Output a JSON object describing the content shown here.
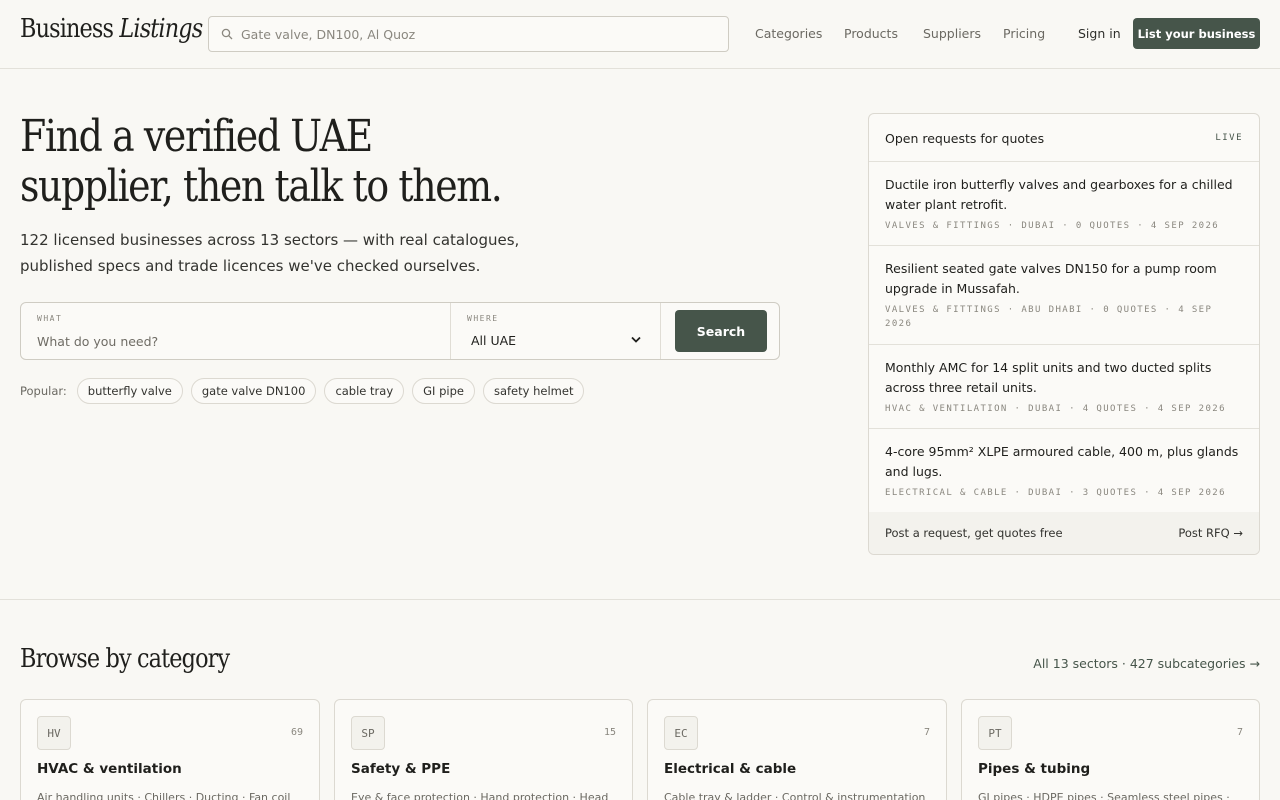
{
  "header": {
    "logo_regular": "Business ",
    "logo_italic": "Listings",
    "search_placeholder": "Gate valve, DN100, Al Quoz",
    "nav": [
      "Categories",
      "Products",
      "Suppliers",
      "Pricing"
    ],
    "sign_in": "Sign in",
    "list_business": "List your business"
  },
  "hero": {
    "title": "Find a verified UAE supplier, then talk to them.",
    "subtitle": "122 licensed businesses across 13 sectors — with real catalogues, published specs and trade licences we've checked ourselves.",
    "search": {
      "what_label": "WHAT",
      "what_placeholder": "What do you need?",
      "where_label": "WHERE",
      "where_value": "All UAE",
      "button": "Search"
    },
    "popular_label": "Popular:",
    "popular": [
      "butterfly valve",
      "gate valve DN100",
      "cable tray",
      "GI pipe",
      "safety helmet"
    ]
  },
  "rfq": {
    "title": "Open requests for quotes",
    "live": "LIVE",
    "items": [
      {
        "text": "Ductile iron butterfly valves and gearboxes for a chilled water plant retrofit.",
        "meta": "Valves & fittings · Dubai · 0 quotes · 4 Sep 2026"
      },
      {
        "text": "Resilient seated gate valves DN150 for a pump room upgrade in Mussafah.",
        "meta": "Valves & fittings · Abu Dhabi · 0 quotes · 4 Sep 2026"
      },
      {
        "text": "Monthly AMC for 14 split units and two ducted splits across three retail units.",
        "meta": "HVAC & ventilation · Dubai · 4 quotes · 4 Sep 2026"
      },
      {
        "text": "4-core 95mm² XLPE armoured cable, 400 m, plus glands and lugs.",
        "meta": "Electrical & cable · Dubai · 3 quotes · 4 Sep 2026"
      }
    ],
    "footer_text": "Post a request, get quotes free",
    "footer_link": "Post RFQ →"
  },
  "browse": {
    "title": "Browse by category",
    "link": "All 13 sectors · 427 subcategories →",
    "cards": [
      {
        "code": "HV",
        "count": "69",
        "title": "HVAC & ventilation",
        "sub": "Air handling units · Chillers · Ducting · Fan coil units"
      },
      {
        "code": "SP",
        "count": "15",
        "title": "Safety & PPE",
        "sub": "Eye & face protection · Hand protection · Head protection"
      },
      {
        "code": "EC",
        "count": "7",
        "title": "Electrical & cable",
        "sub": "Cable tray & ladder · Control & instrumentation cable"
      },
      {
        "code": "PT",
        "count": "7",
        "title": "Pipes & tubing",
        "sub": "GI pipes · HDPE pipes · Seamless steel pipes · PVC pipes"
      }
    ]
  }
}
